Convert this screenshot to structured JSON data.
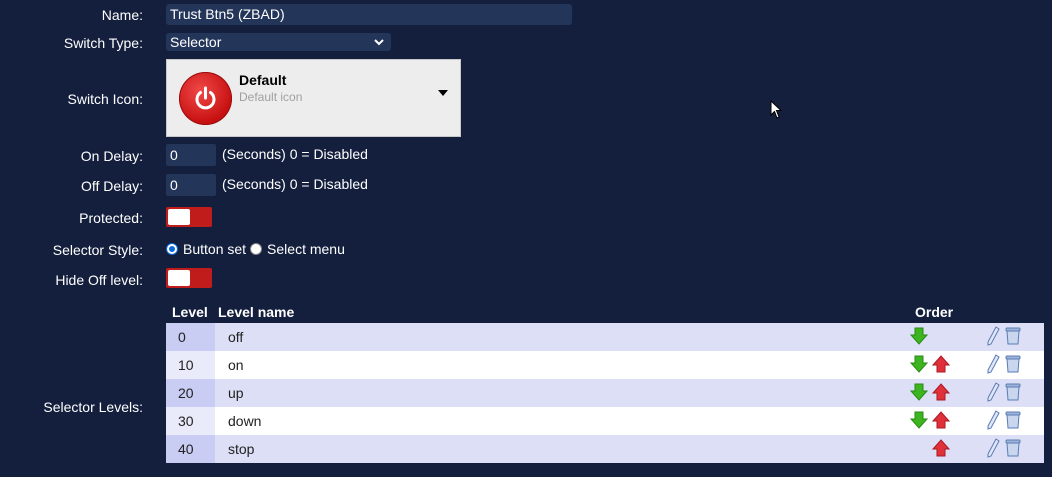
{
  "form": {
    "name_label": "Name:",
    "name_value": "Trust Btn5 (ZBAD)",
    "switch_type_label": "Switch Type:",
    "switch_type_value": "Selector",
    "switch_icon_label": "Switch Icon:",
    "icon_title": "Default",
    "icon_subtitle": "Default icon",
    "on_delay_label": "On Delay:",
    "on_delay_value": "0",
    "on_delay_hint": "(Seconds) 0 = Disabled",
    "off_delay_label": "Off Delay:",
    "off_delay_value": "0",
    "off_delay_hint": "(Seconds) 0 = Disabled",
    "protected_label": "Protected:",
    "protected_on": false,
    "selector_style_label": "Selector Style:",
    "style_option_1": "Button set",
    "style_option_2": "Select menu",
    "style_selected": "Button set",
    "hide_off_label": "Hide Off level:",
    "hide_off_on": false,
    "selector_levels_label": "Selector Levels:"
  },
  "levels_table": {
    "headers": {
      "level": "Level",
      "name": "Level name",
      "order": "Order"
    },
    "rows": [
      {
        "level": "0",
        "name": "off",
        "down": true,
        "up": false
      },
      {
        "level": "10",
        "name": "on",
        "down": true,
        "up": true
      },
      {
        "level": "20",
        "name": "up",
        "down": true,
        "up": true
      },
      {
        "level": "30",
        "name": "down",
        "down": true,
        "up": true
      },
      {
        "level": "40",
        "name": "stop",
        "down": false,
        "up": true
      }
    ]
  },
  "colors": {
    "background": "#131f3d",
    "input_bg": "#24355a",
    "toggle_off": "#c11c1c",
    "arrow_down": "#3cb521",
    "arrow_up": "#e0303a"
  },
  "icons": [
    "power-icon",
    "chevron-down-icon",
    "arrow-down-icon",
    "arrow-up-icon",
    "edit-icon",
    "trash-icon",
    "mouse-cursor-icon"
  ]
}
